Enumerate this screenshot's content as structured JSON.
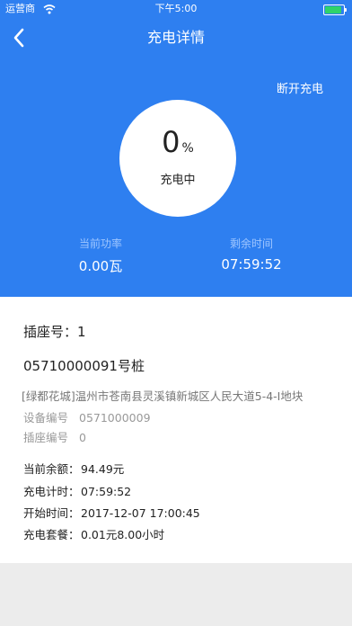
{
  "status_bar": {
    "carrier": "运营商",
    "time": "下午5:00"
  },
  "header": {
    "title": "充电详情",
    "action": "断开充电"
  },
  "progress": {
    "percent": "0",
    "unit": "%",
    "state": "充电中"
  },
  "stats": {
    "power_label": "当前功率",
    "power_value": "0.00瓦",
    "remaining_label": "剩余时间",
    "remaining_value": "07:59:52"
  },
  "details": {
    "socket": "插座号：1",
    "pile": "05710000091号桩",
    "address": "[绿都花城]温州市苍南县灵溪镇新城区人民大道5-4-I地块",
    "device_label": "设备编号",
    "device_value": "0571000009",
    "socket_label": "插座编号",
    "socket_value": "0",
    "balance_label": "当前余额：",
    "balance_value": "94.49元",
    "timer_label": "充电计时：",
    "timer_value": "07:59:52",
    "start_label": "开始时间：",
    "start_value": "2017-12-07 17:00:45",
    "plan_label": "充电套餐：",
    "plan_value": "0.01元8.00小时"
  },
  "colors": {
    "accent": "#2e7ff0",
    "battery": "#2fd36a"
  }
}
